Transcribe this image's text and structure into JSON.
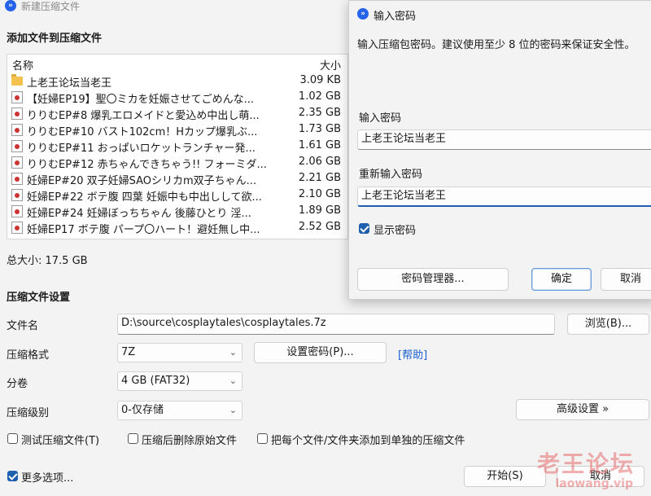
{
  "main_window": {
    "title": "新建压缩文件",
    "add_section_title": "添加文件到压缩文件",
    "file_list": {
      "col_name": "名称",
      "col_size": "大小",
      "rows": [
        {
          "name": "上老王论坛当老王",
          "size": "3.09 KB",
          "icon": "folder-icon"
        },
        {
          "name": "【妊婦EP19】聖〇ミカを妊娠させてごめんな...",
          "size": "1.02 GB",
          "icon": "video-file-icon"
        },
        {
          "name": "りりむEP#8 爆乳エロメイドと愛込め中出し萌...",
          "size": "2.35 GB",
          "icon": "video-file-icon"
        },
        {
          "name": "りりむEP#10 バスト102cm！Hカップ爆乳ぶ...",
          "size": "1.73 GB",
          "icon": "video-file-icon"
        },
        {
          "name": "りりむEP#11 おっぱいロケットランチャー発...",
          "size": "1.61 GB",
          "icon": "video-file-icon"
        },
        {
          "name": "りりむEP#12 赤ちゃんできちゃう!! フォーミダ...",
          "size": "2.06 GB",
          "icon": "video-file-icon"
        },
        {
          "name": "妊婦EP#20 双子妊婦SAOシリカm双子ちゃん...",
          "size": "2.21 GB",
          "icon": "video-file-icon"
        },
        {
          "name": "妊婦EP#22 ボテ腹 四葉 妊娠中も中出しして欲...",
          "size": "2.10 GB",
          "icon": "video-file-icon"
        },
        {
          "name": "妊婦EP#24 妊婦ぼっちちゃん  後藤ひとり  淫...",
          "size": "1.89 GB",
          "icon": "video-file-icon"
        },
        {
          "name": "妊婦EP17 ボテ腹 パープ〇ハート！避妊無し中...",
          "size": "2.52 GB",
          "icon": "video-file-icon"
        }
      ]
    },
    "total_size": "总大小: 17.5 GB",
    "settings_title": "压缩文件设置",
    "filename_label": "文件名",
    "filename_value": "D:\\source\\cosplaytales\\cosplaytales.7z",
    "browse_button": "浏览(B)...",
    "format_label": "压缩格式",
    "format_value": "7Z",
    "set_password_button": "设置密码(P)...",
    "help_link": "[帮助]",
    "split_label": "分卷",
    "split_value": "4 GB (FAT32)",
    "level_label": "压缩级别",
    "level_value": "0-仅存储",
    "advanced_button": "高级设置 »",
    "test_archive": {
      "label": "测试压缩文件(T)",
      "checked": false
    },
    "delete_after": {
      "label": "压缩后删除原始文件",
      "checked": false
    },
    "separate_archive": {
      "label": "把每个文件/文件夹添加到单独的压缩文件",
      "checked": false
    },
    "more_options": {
      "label": "更多选项...",
      "checked": true
    },
    "start_button": "开始(S)",
    "cancel_button": "取消"
  },
  "password_dialog": {
    "title": "输入密码",
    "description": "输入压缩包密码。建议使用至少 8 位的密码来保证安全性。",
    "password_label": "输入密码",
    "password_value": "上老王论坛当老王",
    "confirm_label": "重新输入密码",
    "confirm_value": "上老王论坛当老王",
    "show_password": {
      "label": "显示密码",
      "checked": true
    },
    "manager_button": "密码管理器...",
    "ok_button": "确定",
    "cancel_button": "取消"
  },
  "watermark": {
    "text": "老王论坛",
    "url": "laowang.vip"
  },
  "colors": {
    "accent": "#1f5fb0",
    "link": "#1a5fd0",
    "watermark": "#e25050"
  }
}
